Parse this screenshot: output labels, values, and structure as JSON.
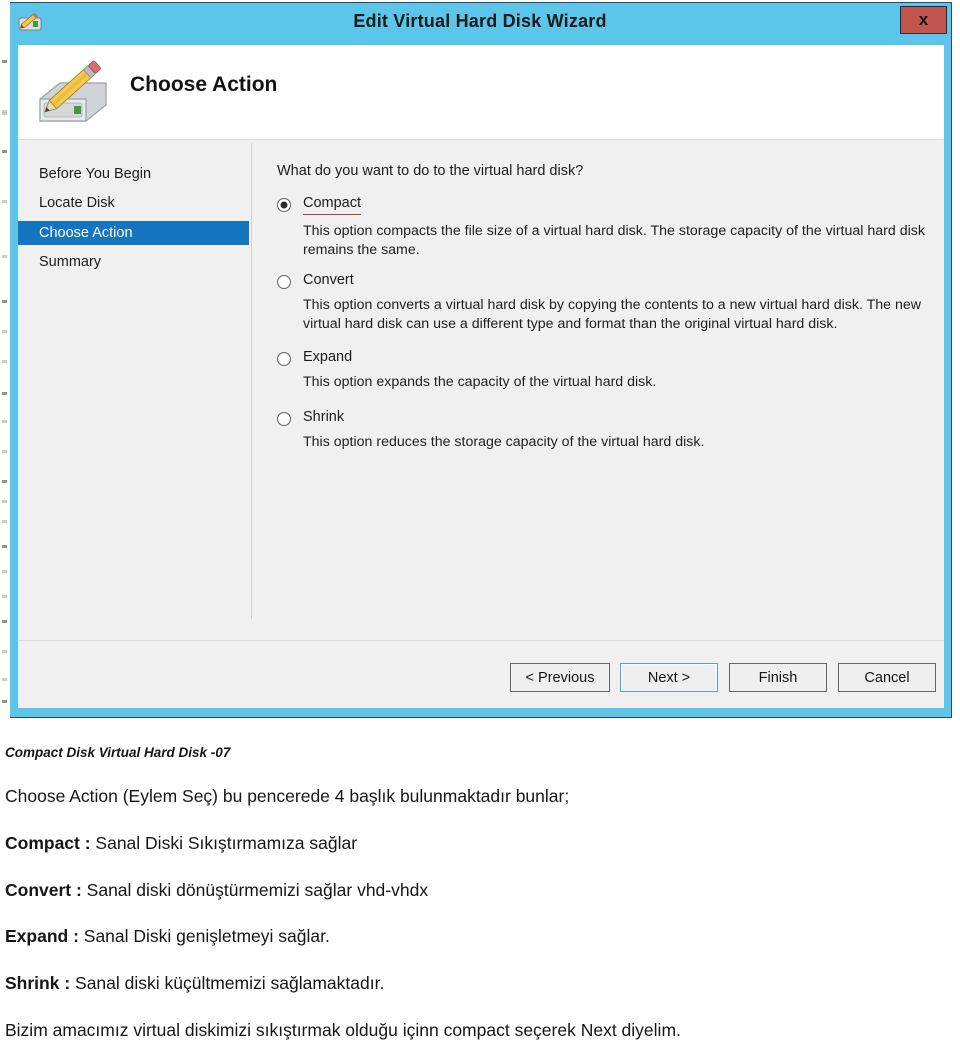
{
  "window": {
    "title": "Edit Virtual Hard Disk Wizard",
    "title_icon": "disk-pencil-icon",
    "close_label": "x",
    "banner_icon": "hard-disk-pencil-icon",
    "banner_title": "Choose Action",
    "frame_color": "#5cc6ea",
    "close_color": "#c0564f"
  },
  "sidebar": {
    "items": [
      {
        "label": "Before You Begin",
        "selected": false
      },
      {
        "label": "Locate Disk",
        "selected": false
      },
      {
        "label": "Choose Action",
        "selected": true
      },
      {
        "label": "Summary",
        "selected": false
      }
    ],
    "selected_color": "#1675c0"
  },
  "content": {
    "question": "What do you want to do to the virtual hard disk?",
    "options": [
      {
        "label": "Compact",
        "checked": true,
        "misspelled": true,
        "description": "This option compacts the file size of a virtual hard disk. The storage capacity of the virtual hard disk remains the same."
      },
      {
        "label": "Convert",
        "checked": false,
        "misspelled": false,
        "description": "This option converts a virtual hard disk by copying the contents to a new virtual hard disk. The new virtual hard disk can use a different type and format than the original virtual hard disk."
      },
      {
        "label": "Expand",
        "checked": false,
        "misspelled": false,
        "description": "This option expands the capacity of the virtual hard disk."
      },
      {
        "label": "Shrink",
        "checked": false,
        "misspelled": false,
        "description": "This option reduces the storage capacity of the virtual hard disk."
      }
    ],
    "spellcheck_underline_color": "#b4413c"
  },
  "footer": {
    "buttons": [
      {
        "label": "< Previous",
        "focused": false
      },
      {
        "label": "Next >",
        "focused": true
      },
      {
        "label": "Finish",
        "focused": false
      },
      {
        "label": "Cancel",
        "focused": false
      }
    ]
  },
  "article": {
    "caption": "Compact Disk Virtual Hard Disk -07",
    "intro": "Choose Action (Eylem Seç) bu pencerede 4 başlık bulunmaktadır bunlar;",
    "entries": [
      {
        "term": "Compact :",
        "text": " Sanal Diski Sıkıştırmamıza sağlar"
      },
      {
        "term": "Convert :",
        "text": " Sanal diski dönüştürmemizi sağlar vhd-vhdx"
      },
      {
        "term": "Expand :",
        "text": " Sanal Diski genişletmeyi sağlar."
      },
      {
        "term": "Shrink :",
        "text": " Sanal diski küçültmemizi sağlamaktadır."
      }
    ],
    "closing": "Bizim amacımız virtual diskimizi sıkıştırmak olduğu içinn compact seçerek Next diyelim."
  }
}
